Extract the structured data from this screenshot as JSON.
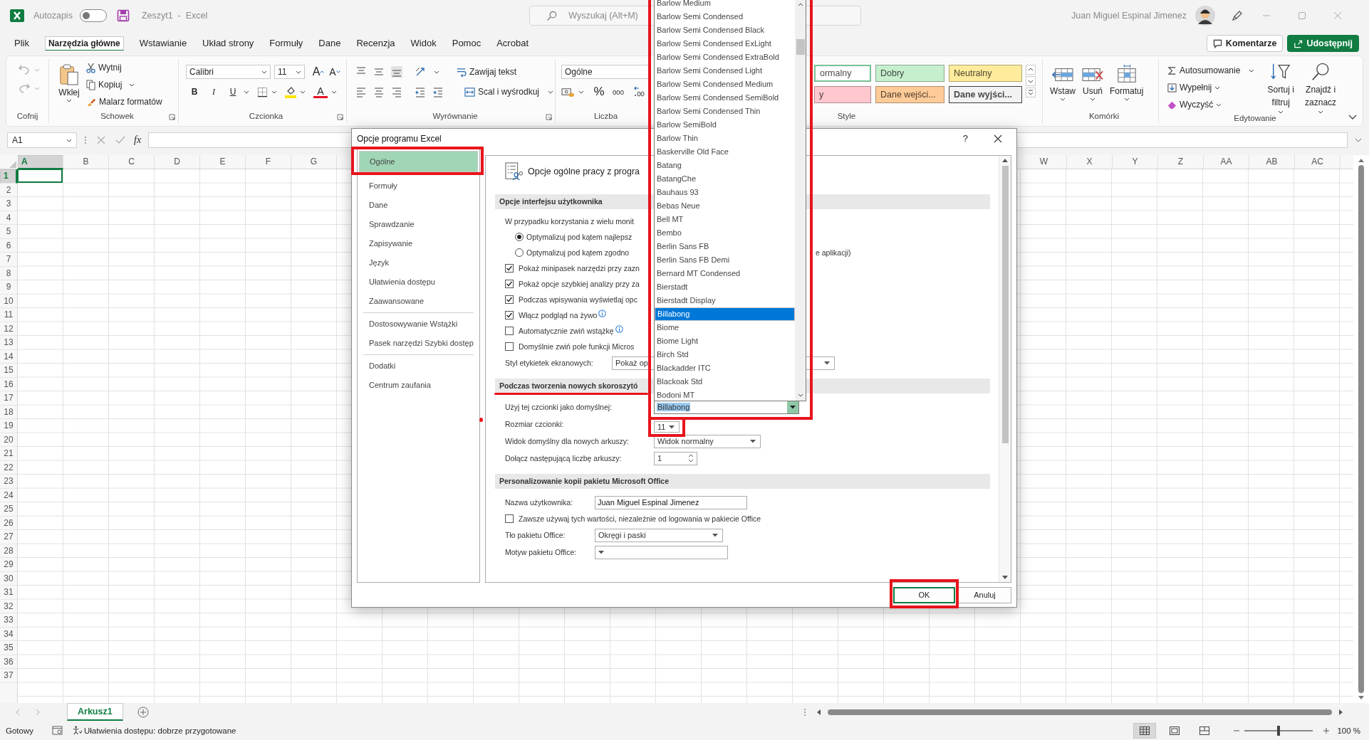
{
  "title_bar": {
    "autosave_label": "Autozapis",
    "autosave_on": false,
    "document_title": "Zeszyt1  -  Excel",
    "search_placeholder": "Wyszukaj (Alt+M)",
    "user_name": "Juan Miguel Espinal Jimenez"
  },
  "menu_tabs": [
    {
      "label": "Plik",
      "selected": false
    },
    {
      "label": "Narzędzia główne",
      "selected": true
    },
    {
      "label": "Wstawianie",
      "selected": false
    },
    {
      "label": "Układ strony",
      "selected": false
    },
    {
      "label": "Formuły",
      "selected": false
    },
    {
      "label": "Dane",
      "selected": false
    },
    {
      "label": "Recenzja",
      "selected": false
    },
    {
      "label": "Widok",
      "selected": false
    },
    {
      "label": "Pomoc",
      "selected": false
    },
    {
      "label": "Acrobat",
      "selected": false
    }
  ],
  "menu_actions": {
    "comments": "Komentarze",
    "share": "Udostępnij"
  },
  "ribbon": {
    "undo": {
      "group_label": "Cofnij"
    },
    "clipboard": {
      "group_label": "Schowek",
      "paste": "Wklej",
      "cut": "Wytnij",
      "copy": "Kopiuj",
      "format_painter": "Malarz formatów"
    },
    "font": {
      "group_label": "Czcionka",
      "font_name": "Calibri",
      "font_size": "11",
      "grow": "A",
      "shrink": "A",
      "bold": "B",
      "italic": "I",
      "underline": "U",
      "font_color": "A"
    },
    "alignment": {
      "group_label": "Wyrównanie",
      "wrap_text": "Zawijaj tekst",
      "merge_center": "Scal i wyśrodkuj"
    },
    "number": {
      "group_label": "Liczba",
      "format": "Ogólne",
      "percent": "%",
      "thousands": "000"
    },
    "styles": {
      "group_label": "Style",
      "tiles": [
        {
          "label": "ormalny",
          "color": "#ffffff"
        },
        {
          "label": "Dobry",
          "color": "#c6efce"
        },
        {
          "label": "Neutralny",
          "color": "#ffeb9c"
        },
        {
          "label": "y",
          "color": "#ffc7ce"
        },
        {
          "label": "Dane wejści...",
          "color": "#ffcc99"
        },
        {
          "label": "Dane wyjści...",
          "color": "#f2f2f2"
        }
      ]
    },
    "cells": {
      "group_label": "Komórki",
      "buttons": [
        {
          "label": "Wstaw",
          "kind": "insert"
        },
        {
          "label": "Usuń",
          "kind": "delete"
        },
        {
          "label": "Formatuj",
          "kind": "format"
        }
      ]
    },
    "editing": {
      "group_label": "Edytowanie",
      "autosum": "Autosumowanie",
      "fill": "Wypełnij",
      "clear": "Wyczyść",
      "sort_filter": "Sortuj i filtruj",
      "find_select": "Znajdź i zaznacz"
    }
  },
  "formula_bar": {
    "name_box": "A1",
    "function_label": "fx"
  },
  "sheet": {
    "columns_left": [
      {
        "label": "A",
        "selected": true
      },
      {
        "label": "B",
        "selected": false
      },
      {
        "label": "C",
        "selected": false
      },
      {
        "label": "D",
        "selected": false
      },
      {
        "label": "E",
        "selected": false
      },
      {
        "label": "F",
        "selected": false
      },
      {
        "label": "G",
        "selected": false
      }
    ],
    "columns_right": [
      {
        "label": "W",
        "selected": false
      },
      {
        "label": "X",
        "selected": false
      },
      {
        "label": "Y",
        "selected": false
      },
      {
        "label": "Z",
        "selected": false
      },
      {
        "label": "AA",
        "selected": false
      },
      {
        "label": "AB",
        "selected": false
      },
      {
        "label": "AC",
        "selected": false
      }
    ],
    "rows": [
      {
        "label": "1",
        "selected": true
      },
      {
        "label": "2",
        "selected": false
      },
      {
        "label": "3",
        "selected": false
      },
      {
        "label": "4",
        "selected": false
      },
      {
        "label": "5",
        "selected": false
      },
      {
        "label": "6",
        "selected": false
      },
      {
        "label": "7",
        "selected": false
      },
      {
        "label": "8",
        "selected": false
      },
      {
        "label": "9",
        "selected": false
      },
      {
        "label": "10",
        "selected": false
      },
      {
        "label": "11",
        "selected": false
      },
      {
        "label": "12",
        "selected": false
      },
      {
        "label": "13",
        "selected": false
      },
      {
        "label": "14",
        "selected": false
      },
      {
        "label": "15",
        "selected": false
      },
      {
        "label": "16",
        "selected": false
      },
      {
        "label": "17",
        "selected": false
      },
      {
        "label": "18",
        "selected": false
      },
      {
        "label": "19",
        "selected": false
      },
      {
        "label": "20",
        "selected": false
      },
      {
        "label": "21",
        "selected": false
      },
      {
        "label": "22",
        "selected": false
      },
      {
        "label": "23",
        "selected": false
      },
      {
        "label": "24",
        "selected": false
      },
      {
        "label": "25",
        "selected": false
      },
      {
        "label": "26",
        "selected": false
      },
      {
        "label": "27",
        "selected": false
      },
      {
        "label": "28",
        "selected": false
      },
      {
        "label": "29",
        "selected": false
      },
      {
        "label": "30",
        "selected": false
      },
      {
        "label": "31",
        "selected": false
      },
      {
        "label": "32",
        "selected": false
      },
      {
        "label": "33",
        "selected": false
      },
      {
        "label": "34",
        "selected": false
      },
      {
        "label": "35",
        "selected": false
      },
      {
        "label": "36",
        "selected": false
      },
      {
        "label": "37",
        "selected": false
      }
    ]
  },
  "sheet_tabs": [
    {
      "label": "Arkusz1",
      "selected": true
    }
  ],
  "status_bar": {
    "ready": "Gotowy",
    "accessibility": "Ułatwienia dostępu: dobrze przygotowane",
    "views": [
      {
        "kind": "normal",
        "selected": true
      },
      {
        "kind": "page_layout",
        "selected": false
      },
      {
        "kind": "page_break",
        "selected": false
      }
    ],
    "zoom": {
      "level": 0.5,
      "reading": "100 %"
    }
  },
  "dialog": {
    "title": "Opcje programu Excel",
    "help": "?",
    "nav_groups": [
      {
        "items": [
          {
            "label": "Ogólne",
            "selected": true
          },
          {
            "label": "Formuły",
            "selected": false
          },
          {
            "label": "Dane",
            "selected": false
          },
          {
            "label": "Sprawdzanie",
            "selected": false
          },
          {
            "label": "Zapisywanie",
            "selected": false
          },
          {
            "label": "Język",
            "selected": false
          },
          {
            "label": "Ułatwienia dostępu",
            "selected": false
          },
          {
            "label": "Zaawansowane",
            "selected": false
          }
        ]
      },
      {
        "items": [
          {
            "label": "Dostosowywanie Wstążki",
            "selected": false
          },
          {
            "label": "Pasek narzędzi Szybki dostęp",
            "selected": false
          }
        ]
      },
      {
        "items": [
          {
            "label": "Dodatki",
            "selected": false
          },
          {
            "label": "Centrum zaufania",
            "selected": false
          }
        ]
      }
    ],
    "heading": "Opcje ogólne pracy z progra",
    "sections": [
      {
        "title": "Opcje interfejsu użytkownika",
        "rows": [
          {
            "kind": "text",
            "label": "W przypadku korzystania z wielu monit"
          },
          {
            "kind": "radio",
            "label": "Optymalizuj pod kątem najlepsz",
            "selected": true
          },
          {
            "kind": "radio",
            "label": "Optymalizuj pod kątem zgodno",
            "selected": false,
            "tail": "e aplikacji)"
          },
          {
            "kind": "checkbox",
            "label": "Pokaż minipasek narzędzi przy zazn",
            "checked": true,
            "info": false
          },
          {
            "kind": "checkbox",
            "label": "Pokaż opcje szybkiej analizy przy za",
            "checked": true,
            "info": false
          },
          {
            "kind": "checkbox",
            "label": "Podczas wpisywania wyświetlaj opc",
            "checked": true,
            "info": false
          },
          {
            "kind": "checkbox",
            "label": "Włącz podgląd na żywo",
            "checked": true,
            "info": true
          },
          {
            "kind": "checkbox",
            "label": "Automatycznie zwiń wstążkę",
            "checked": false,
            "info": true
          },
          {
            "kind": "checkbox",
            "label": "Domyślnie zwiń pole funkcji Micros",
            "checked": false,
            "info": false
          },
          {
            "kind": "select",
            "label": "Styl etykietek ekranowych:",
            "value": "Pokaż op"
          }
        ]
      },
      {
        "title": "Podczas tworzenia nowych skoroszytó",
        "rows": [
          {
            "kind": "combo",
            "label": "Użyj tej czcionki jako domyślnej:",
            "value": "Billabong"
          },
          {
            "kind": "select",
            "label": "Rozmiar czcionki:",
            "value": "11"
          },
          {
            "kind": "select",
            "label": "Widok domyślny dla nowych arkuszy:",
            "value": "Widok normalny"
          },
          {
            "kind": "spinner",
            "label": "Dołącz następującą liczbę arkuszy:",
            "value": "1"
          }
        ]
      },
      {
        "title": "Personalizowanie kopii pakietu Microsoft Office",
        "rows": [
          {
            "kind": "input",
            "label": "Nazwa użytkownika:",
            "value": "Juan Miguel Espinal Jimenez"
          },
          {
            "kind": "checkbox",
            "label": "Zawsze używaj tych wartości, niezależnie od logowania w pakiecie Office",
            "checked": false,
            "info": false
          },
          {
            "kind": "select",
            "label": "Tło pakietu Office:",
            "value": "Okręgi i paski"
          },
          {
            "kind": "select",
            "label": "Motyw pakietu Office:"
          }
        ]
      }
    ],
    "buttons": [
      {
        "label": "OK",
        "kind": "default"
      },
      {
        "label": "Anuluj",
        "kind": "normal"
      }
    ]
  },
  "font_list": {
    "items": [
      {
        "label": "Barlow Medium",
        "selected": false
      },
      {
        "label": "Barlow Semi Condensed",
        "selected": false
      },
      {
        "label": "Barlow Semi Condensed Black",
        "selected": false
      },
      {
        "label": "Barlow Semi Condensed ExLight",
        "selected": false
      },
      {
        "label": "Barlow Semi Condensed ExtraBold",
        "selected": false
      },
      {
        "label": "Barlow Semi Condensed Light",
        "selected": false
      },
      {
        "label": "Barlow Semi Condensed Medium",
        "selected": false
      },
      {
        "label": "Barlow Semi Condensed SemiBold",
        "selected": false
      },
      {
        "label": "Barlow Semi Condensed Thin",
        "selected": false
      },
      {
        "label": "Barlow SemiBold",
        "selected": false
      },
      {
        "label": "Barlow Thin",
        "selected": false
      },
      {
        "label": "Baskerville Old Face",
        "selected": false
      },
      {
        "label": "Batang",
        "selected": false
      },
      {
        "label": "BatangChe",
        "selected": false
      },
      {
        "label": "Bauhaus 93",
        "selected": false
      },
      {
        "label": "Bebas Neue",
        "selected": false
      },
      {
        "label": "Bell MT",
        "selected": false
      },
      {
        "label": "Bembo",
        "selected": false
      },
      {
        "label": "Berlin Sans FB",
        "selected": false
      },
      {
        "label": "Berlin Sans FB Demi",
        "selected": false
      },
      {
        "label": "Bernard MT Condensed",
        "selected": false
      },
      {
        "label": "Bierstadt",
        "selected": false
      },
      {
        "label": "Bierstadt Display",
        "selected": false
      },
      {
        "label": "Billabong",
        "selected": true
      },
      {
        "label": "Biome",
        "selected": false
      },
      {
        "label": "Biome Light",
        "selected": false
      },
      {
        "label": "Birch Std",
        "selected": false
      },
      {
        "label": "Blackadder ITC",
        "selected": false
      },
      {
        "label": "Blackoak Std",
        "selected": false
      },
      {
        "label": "Bodoni MT",
        "selected": false
      }
    ]
  }
}
